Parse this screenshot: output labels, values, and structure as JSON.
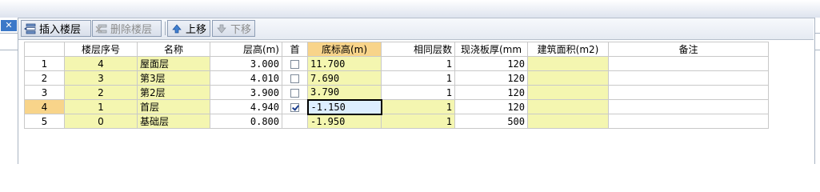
{
  "toolbar": {
    "insert_label": "插入楼层",
    "delete_label": "删除楼层",
    "move_up_label": "上移",
    "move_down_label": "下移"
  },
  "panel": {
    "close_glyph": "✕"
  },
  "columns": [
    "楼层序号",
    "名称",
    "层高(m)",
    "首",
    "底标高(m)",
    "相同层数",
    "现浇板厚(mm",
    "建筑面积(m2)",
    "备注"
  ],
  "rows": [
    {
      "index": "1",
      "seq": "4",
      "name": "屋面层",
      "height": "3.000",
      "first": false,
      "bottom": "11.700",
      "same": "1",
      "slab": "120",
      "area": "",
      "note": ""
    },
    {
      "index": "2",
      "seq": "3",
      "name": "第3层",
      "height": "4.010",
      "first": false,
      "bottom": "7.690",
      "same": "1",
      "slab": "120",
      "area": "",
      "note": ""
    },
    {
      "index": "3",
      "seq": "2",
      "name": "第2层",
      "height": "3.900",
      "first": false,
      "bottom": "3.790",
      "same": "1",
      "slab": "120",
      "area": "",
      "note": ""
    },
    {
      "index": "4",
      "seq": "1",
      "name": "首层",
      "height": "4.940",
      "first": true,
      "bottom": "-1.150",
      "same": "1",
      "slab": "120",
      "area": "",
      "note": ""
    },
    {
      "index": "5",
      "seq": "0",
      "name": "基础层",
      "height": "0.800",
      "first": null,
      "bottom": "-1.950",
      "same": "1",
      "slab": "500",
      "area": "",
      "note": ""
    }
  ],
  "selection": {
    "row": "4",
    "column": "底标高(m)"
  },
  "colors": {
    "header_selected": "#f8d48a",
    "editable_cell": "#f4f6b0",
    "active_cell": "#ddeeff"
  }
}
